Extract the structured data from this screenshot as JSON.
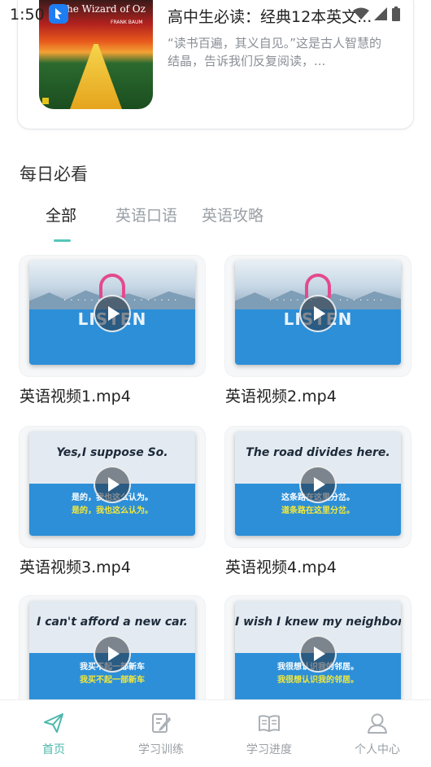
{
  "status": {
    "time": "1:50"
  },
  "book": {
    "cover_title": "The Wizard of Oz",
    "cover_author": "FRANK BAUM",
    "title": "高中生必读：经典12本英文...",
    "description": "“读书百遍，其义自见。”这是古人智慧的结晶，告诉我们反复阅读，..."
  },
  "section": {
    "title": "每日必看"
  },
  "tabs": [
    {
      "label": "全部"
    },
    {
      "label": "英语口语"
    },
    {
      "label": "英语攻略"
    }
  ],
  "videos": [
    {
      "name": "英语视频1.mp4",
      "thumb_text": "LISTEN"
    },
    {
      "name": "英语视频2.mp4",
      "thumb_text": "LISTEN"
    },
    {
      "name": "英语视频3.mp4",
      "phrase_en": "Yes,I suppose So.",
      "phrase_cn1": "是的，我也这么认为。",
      "phrase_cn2": "是的，我也这么认为。"
    },
    {
      "name": "英语视频4.mp4",
      "phrase_en": "The road divides here.",
      "phrase_cn1": "这条路在这里分岔。",
      "phrase_cn2": "道条路在这里分岔。"
    },
    {
      "name": "",
      "phrase_en": "I can't afford a new car.",
      "phrase_cn1": "我买不起一部新车",
      "phrase_cn2": "我买不起一部新车"
    },
    {
      "name": "",
      "phrase_en": "I wish I knew my neighbor.",
      "phrase_cn1": "我很想认识我的邻居。",
      "phrase_cn2": "我很想认识我的邻居。"
    }
  ],
  "bottom_nav": [
    {
      "label": "首页",
      "icon": "paper-plane-icon"
    },
    {
      "label": "学习训练",
      "icon": "edit-note-icon"
    },
    {
      "label": "学习进度",
      "icon": "open-book-icon"
    },
    {
      "label": "个人中心",
      "icon": "user-icon"
    }
  ],
  "colors": {
    "accent": "#4cb8ad",
    "tab_indicator": "#55c6ba",
    "water": "#2d8fd8"
  }
}
